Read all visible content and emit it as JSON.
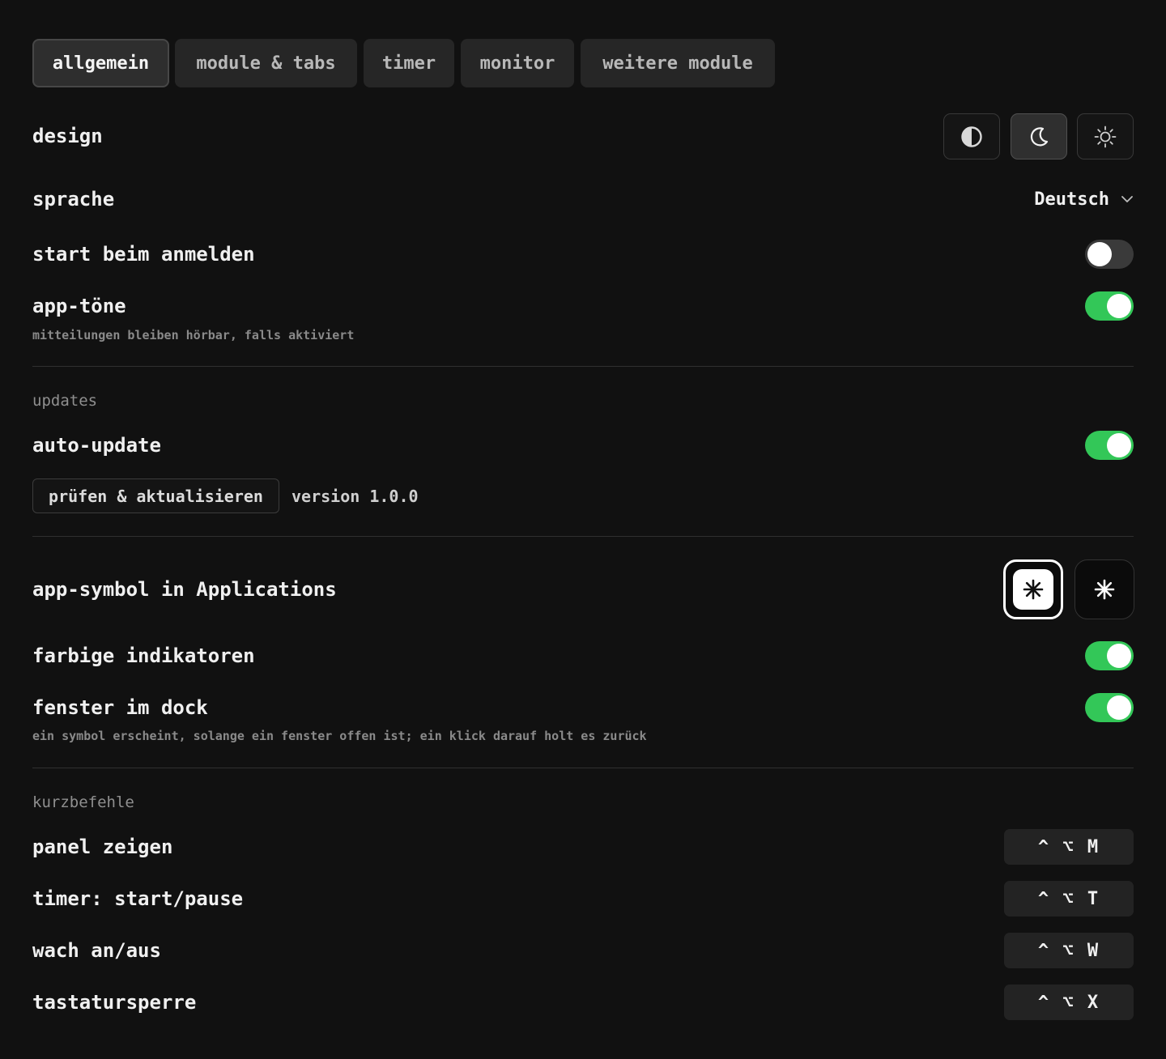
{
  "tabs": [
    {
      "label": "allgemein",
      "active": true
    },
    {
      "label": "module & tabs",
      "active": false
    },
    {
      "label": "timer",
      "active": false
    },
    {
      "label": "monitor",
      "active": false
    },
    {
      "label": "weitere module",
      "active": false
    }
  ],
  "design": {
    "label": "design",
    "options": [
      {
        "icon": "half-circle-icon",
        "name": "system"
      },
      {
        "icon": "moon-icon",
        "name": "dark",
        "active": true
      },
      {
        "icon": "sun-icon",
        "name": "light"
      }
    ]
  },
  "language": {
    "label": "sprache",
    "value": "Deutsch",
    "icon": "chevron-down-icon"
  },
  "start_login": {
    "label": "start beim anmelden",
    "enabled": false
  },
  "app_tones": {
    "label": "app-töne",
    "hint": "mitteilungen bleiben hörbar, falls aktiviert",
    "enabled": true
  },
  "updates": {
    "section_title": "updates",
    "auto_update_label": "auto-update",
    "auto_update_enabled": true,
    "check_button": "prüfen & aktualisieren",
    "version": "version 1.0.0"
  },
  "app_symbol": {
    "label": "app-symbol in Applications",
    "options": [
      "light",
      "dark"
    ],
    "selected": "light",
    "icon": "asterisk-icon"
  },
  "colored_indicators": {
    "label": "farbige indikatoren",
    "enabled": true
  },
  "window_dock": {
    "label": "fenster im dock",
    "hint": "ein symbol erscheint, solange ein fenster offen ist; ein klick darauf holt es zurück",
    "enabled": true
  },
  "shortcuts": {
    "section_title": "kurzbefehle",
    "items": [
      {
        "label": "panel zeigen",
        "keys": "^ ⌥ M"
      },
      {
        "label": "timer: start/pause",
        "keys": "^ ⌥ T"
      },
      {
        "label": "wach an/aus",
        "keys": "^ ⌥ W"
      },
      {
        "label": "tastatursperre",
        "keys": "^ ⌥ X"
      }
    ]
  },
  "colors": {
    "background": "#111111",
    "toggle_on": "#33c758",
    "toggle_off": "#3a3a3a",
    "text": "#f0f0f0",
    "muted": "#8a8a8a"
  }
}
